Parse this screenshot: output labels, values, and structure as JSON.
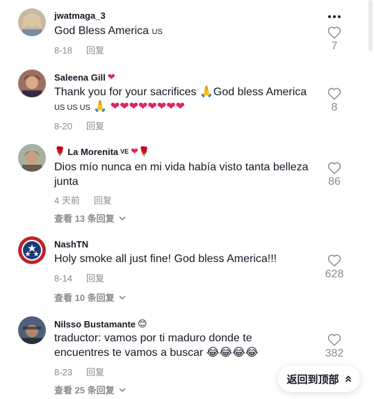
{
  "more_icon": "more-horizontal-icon",
  "comments": [
    {
      "username": "jwatmaga_3",
      "username_suffix": "",
      "text": "God Bless America ",
      "flags": "US",
      "date": "8-18",
      "reply_label": "回复",
      "likes": "7"
    },
    {
      "username": "Saleena Gill",
      "username_suffix": "❤",
      "text_line1": "Thank you for your sacrifices 🙏God bless America",
      "text_line2_flags": "US US US",
      "text_line2_rest": " 🙏 ❤❤❤❤❤❤❤❤",
      "date": "8-20",
      "reply_label": "回复",
      "likes": "8"
    },
    {
      "username_prefix": "🌹",
      "username": "La Morenita",
      "username_tag": "VE",
      "username_suffix": "❤🌹",
      "text": "Dios mío nunca en mi vida había visto tanta belleza junta",
      "date": "4 天前",
      "reply_label": "回复",
      "likes": "86",
      "view_replies": "查看 13 条回复"
    },
    {
      "username": "NashTN",
      "text": "Holy smoke all just fine! God bless America!!!",
      "date": "8-14",
      "reply_label": "回复",
      "likes": "628",
      "view_replies": "查看 10 条回复"
    },
    {
      "username": "Nilsso Bustamante",
      "username_suffix": "😊",
      "text": "traductor: vamos por ti maduro donde te encuentres te vamos a buscar 😂😂😂😂",
      "date": "8-23",
      "reply_label": "回复",
      "likes": "382",
      "view_replies": "查看 25 条回复"
    }
  ],
  "back_to_top": "返回到顶部"
}
